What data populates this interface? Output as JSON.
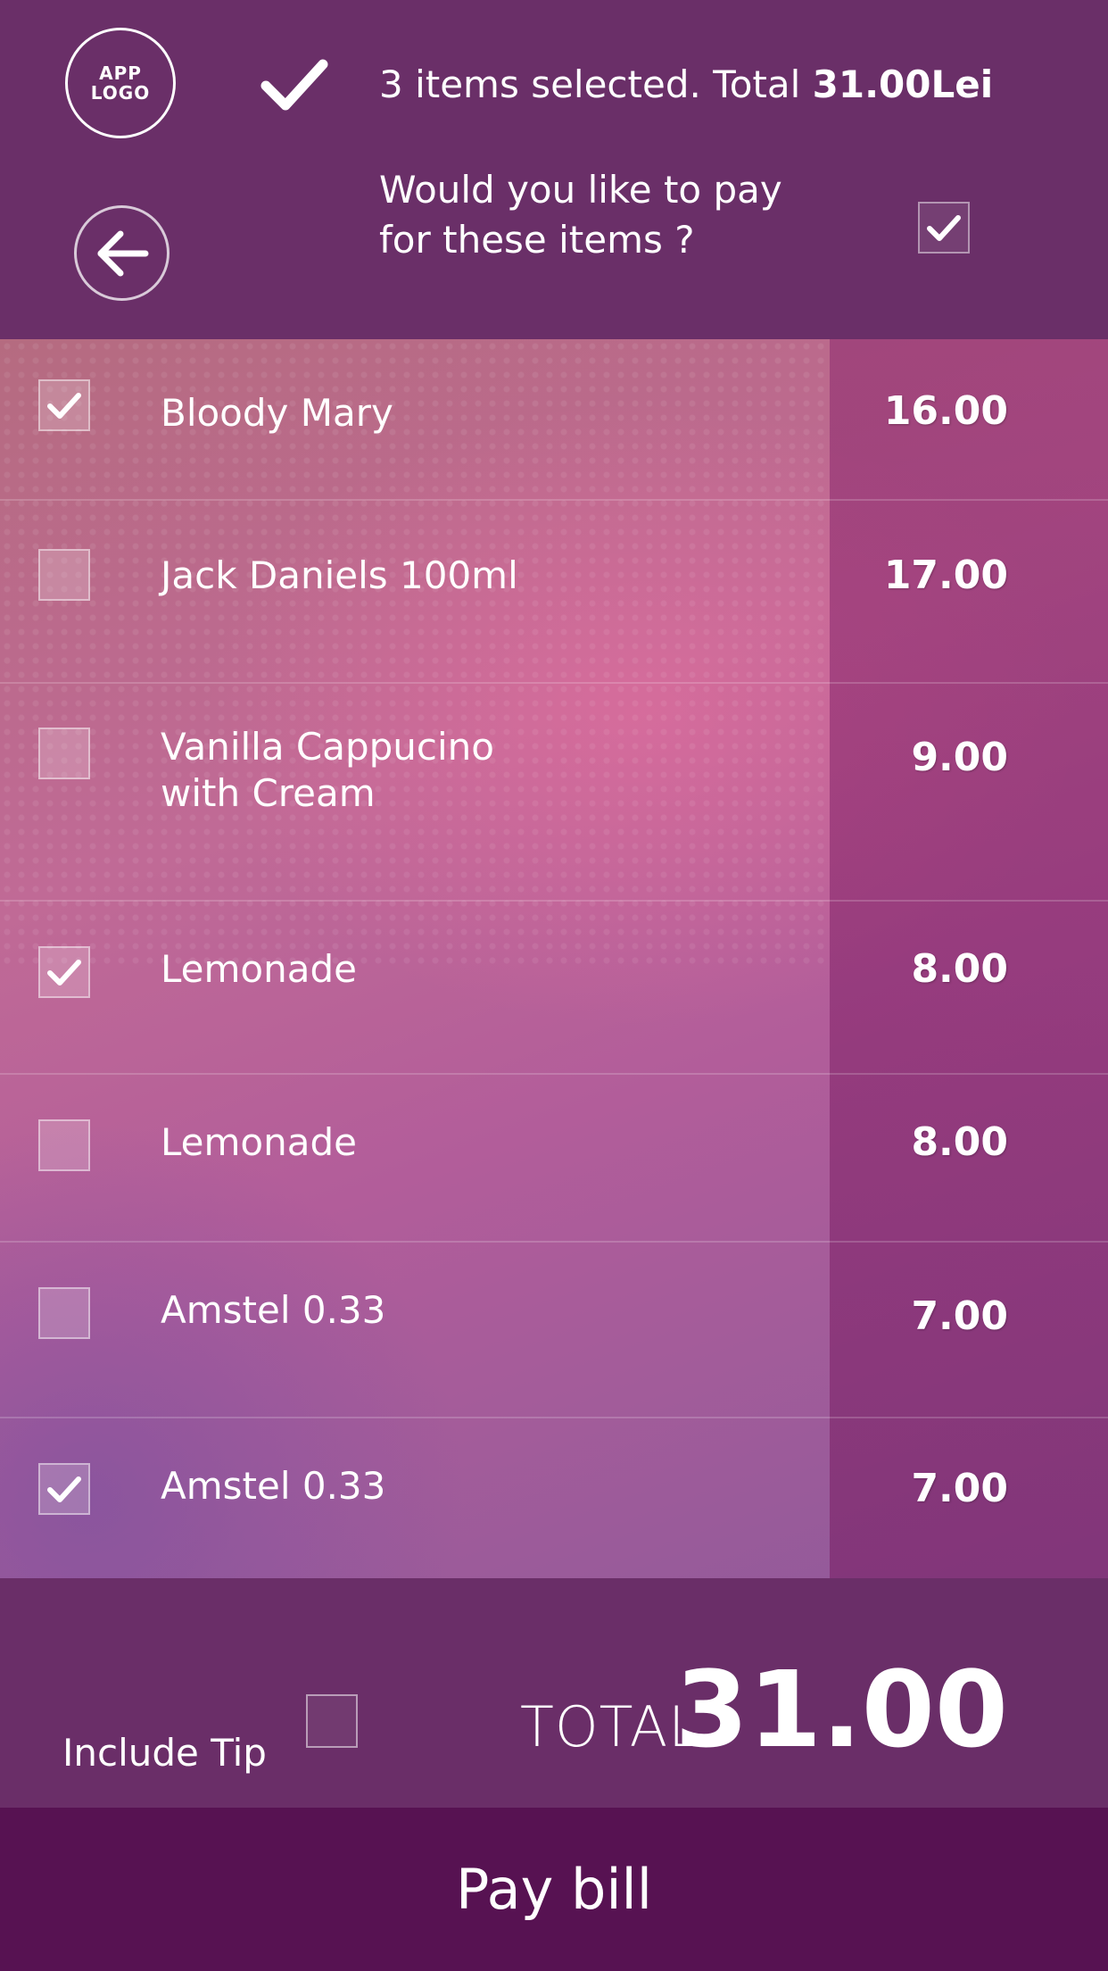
{
  "header": {
    "logo_line1": "APP",
    "logo_line2": "LOGO",
    "summary_prefix": "3 items selected. Total ",
    "summary_total": "31.00Lei",
    "question": "Would you like to pay for these items ?",
    "confirm_checked": true
  },
  "items": [
    {
      "name": "Bloody Mary",
      "price": "16.00",
      "checked": true
    },
    {
      "name": "Jack Daniels 100ml",
      "price": "17.00",
      "checked": false
    },
    {
      "name": "Vanilla Cappucino\nwith Cream",
      "price": "9.00",
      "checked": false
    },
    {
      "name": "Lemonade",
      "price": "8.00",
      "checked": true
    },
    {
      "name": "Lemonade",
      "price": "8.00",
      "checked": false
    },
    {
      "name": "Amstel 0.33",
      "price": "7.00",
      "checked": false
    },
    {
      "name": "Amstel 0.33",
      "price": "7.00",
      "checked": true
    }
  ],
  "footer": {
    "tip_label": "Include Tip",
    "tip_checked": false,
    "total_label": "TOTAL",
    "total_value": "31.00",
    "pay_label": "Pay bill"
  },
  "colors": {
    "header_bg": "#6a2f68",
    "paybar_bg": "#571252",
    "accent": "#c06a96"
  },
  "icons": [
    "check-icon",
    "arrow-left-icon"
  ]
}
